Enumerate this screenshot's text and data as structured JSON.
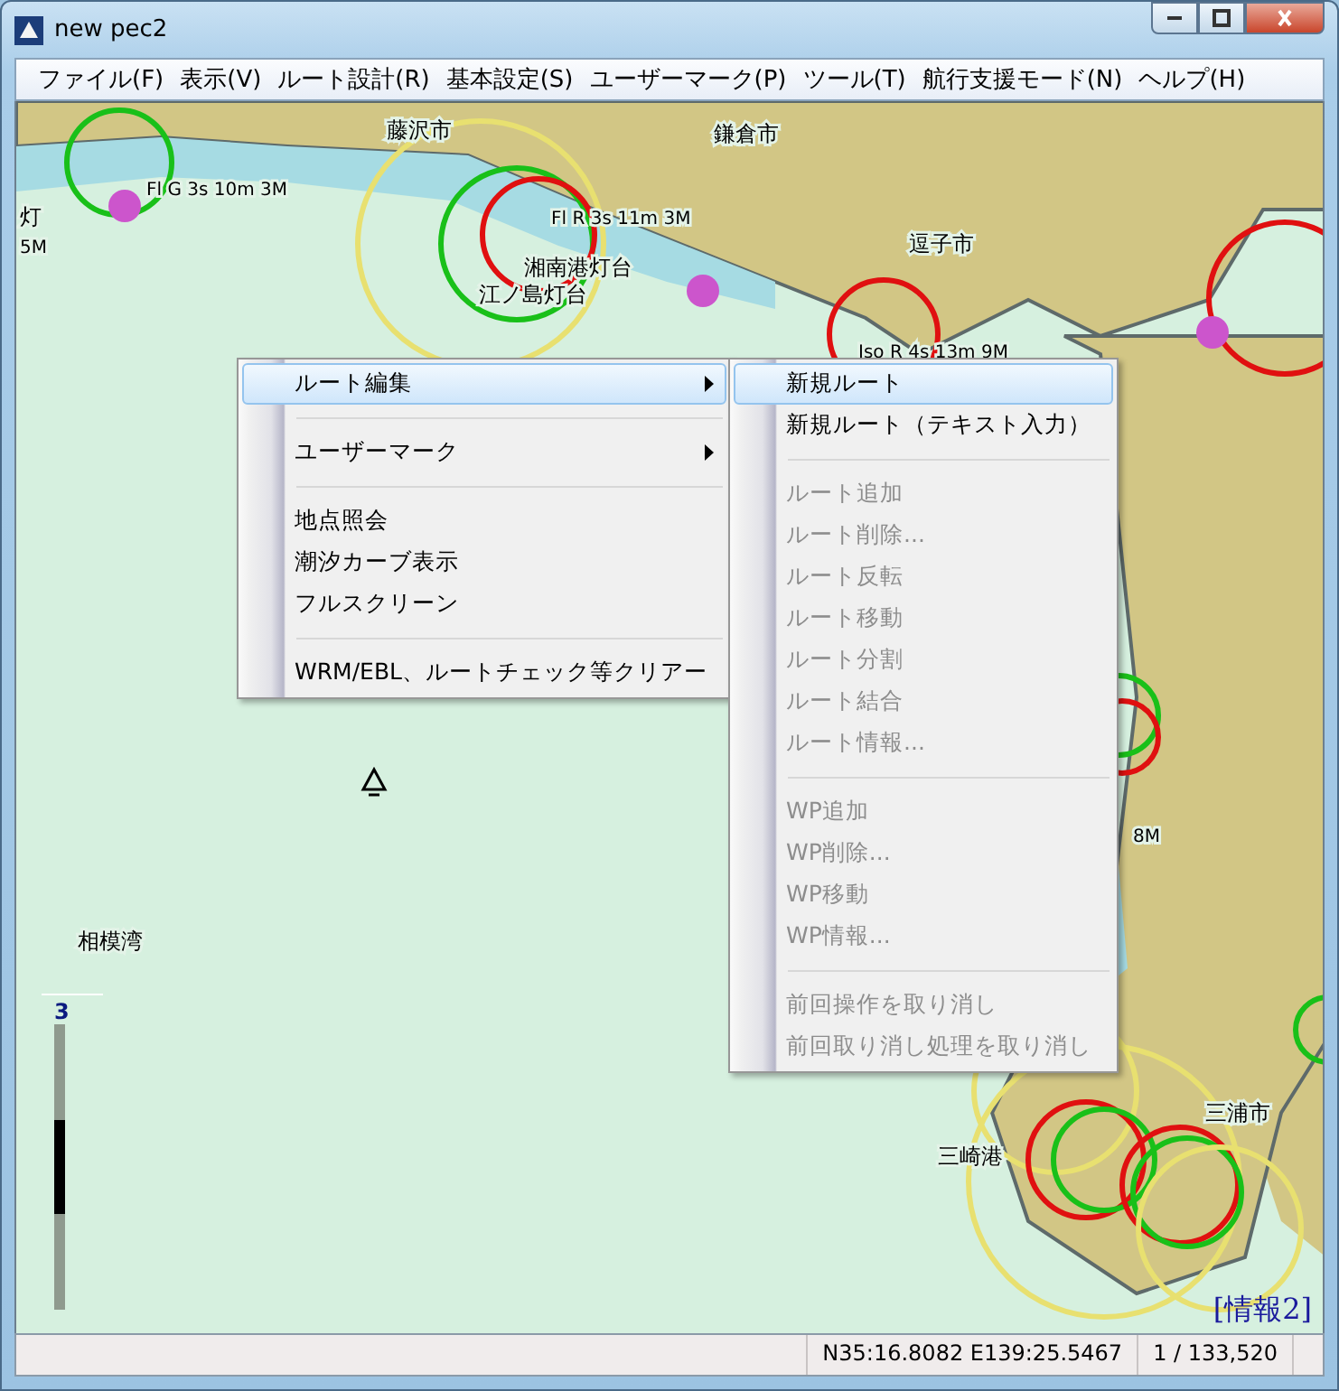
{
  "window": {
    "title": "new pec2"
  },
  "menu_bar": [
    {
      "label": "ファイル(F)"
    },
    {
      "label": "表示(V)"
    },
    {
      "label": "ルート設計(R)"
    },
    {
      "label": "基本設定(S)"
    },
    {
      "label": "ユーザーマーク(P)"
    },
    {
      "label": "ツール(T)"
    },
    {
      "label": "航行支援モード(N)"
    },
    {
      "label": "ヘルプ(H)"
    }
  ],
  "map": {
    "labels": [
      {
        "kind": "place",
        "text": "藤沢市"
      },
      {
        "kind": "place",
        "text": "鎌倉市"
      },
      {
        "kind": "place",
        "text": "逗子市"
      },
      {
        "kind": "place",
        "text": "相模湾"
      },
      {
        "kind": "place",
        "text": "三浦市"
      },
      {
        "kind": "place",
        "text": "三崎港"
      },
      {
        "kind": "light",
        "text": "Fl G 3s 10m 3M"
      },
      {
        "kind": "light",
        "text": "Fl R 3s 11m 3M"
      },
      {
        "kind": "place",
        "text": "湘南港灯台"
      },
      {
        "kind": "place",
        "text": "江ノ島灯台"
      },
      {
        "kind": "light",
        "text": "Iso R 4s 13m 9M"
      },
      {
        "kind": "place",
        "text": "灯"
      },
      {
        "kind": "light",
        "text": "5M"
      },
      {
        "kind": "light",
        "text": "8M"
      }
    ],
    "scale_level": "3",
    "zoom_slider": {
      "level": 0.5
    },
    "info_label": "[情報2]"
  },
  "context_menu": {
    "items": [
      {
        "kind": "item",
        "label": "ルート編集",
        "selected": true,
        "submenu": true
      },
      {
        "kind": "separator"
      },
      {
        "kind": "item",
        "label": "ユーザーマーク",
        "selected": false,
        "submenu": true
      },
      {
        "kind": "separator"
      },
      {
        "kind": "item",
        "label": "地点照会",
        "selected": false,
        "submenu": false
      },
      {
        "kind": "item",
        "label": "潮汐カーブ表示",
        "selected": false,
        "submenu": false
      },
      {
        "kind": "item",
        "label": "フルスクリーン",
        "selected": false,
        "submenu": false
      },
      {
        "kind": "separator"
      },
      {
        "kind": "item",
        "label": "WRM/EBL、ルートチェック等クリアー",
        "selected": false,
        "submenu": false
      }
    ]
  },
  "submenu": {
    "items": [
      {
        "kind": "item",
        "label": "新規ルート",
        "selected": true,
        "disabled": false
      },
      {
        "kind": "item",
        "label": "新規ルート（テキスト入力）",
        "selected": false,
        "disabled": false
      },
      {
        "kind": "separator"
      },
      {
        "kind": "item",
        "label": "ルート追加",
        "selected": false,
        "disabled": true
      },
      {
        "kind": "item",
        "label": "ルート削除...",
        "selected": false,
        "disabled": true
      },
      {
        "kind": "item",
        "label": "ルート反転",
        "selected": false,
        "disabled": true
      },
      {
        "kind": "item",
        "label": "ルート移動",
        "selected": false,
        "disabled": true
      },
      {
        "kind": "item",
        "label": "ルート分割",
        "selected": false,
        "disabled": true
      },
      {
        "kind": "item",
        "label": "ルート結合",
        "selected": false,
        "disabled": true
      },
      {
        "kind": "item",
        "label": "ルート情報...",
        "selected": false,
        "disabled": true
      },
      {
        "kind": "separator"
      },
      {
        "kind": "item",
        "label": "WP追加",
        "selected": false,
        "disabled": true
      },
      {
        "kind": "item",
        "label": "WP削除...",
        "selected": false,
        "disabled": true
      },
      {
        "kind": "item",
        "label": "WP移動",
        "selected": false,
        "disabled": true
      },
      {
        "kind": "item",
        "label": "WP情報...",
        "selected": false,
        "disabled": true
      },
      {
        "kind": "separator"
      },
      {
        "kind": "item",
        "label": "前回操作を取り消し",
        "selected": false,
        "disabled": true
      },
      {
        "kind": "item",
        "label": "前回取り消し処理を取り消し",
        "selected": false,
        "disabled": true
      }
    ]
  },
  "status_bar": {
    "coordinates": "N35:16.8082 E139:25.5467",
    "scale": "1 / 133,520"
  }
}
